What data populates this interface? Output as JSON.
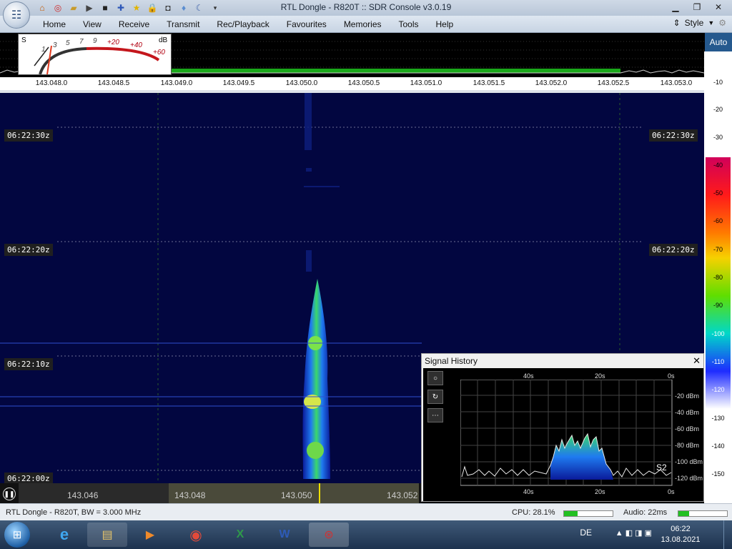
{
  "window": {
    "title": "RTL Dongle - R820T :: SDR Console v3.0.19",
    "controls": [
      "minimize-icon",
      "restore-icon",
      "close-icon"
    ]
  },
  "quick_access": [
    "home-icon",
    "lifebuoy-icon",
    "folder-icon",
    "play-icon",
    "stop-icon",
    "plus-icon",
    "star-icon",
    "lock-icon",
    "camera-icon",
    "drop-icon",
    "moon-icon",
    "dropdown-icon"
  ],
  "ribbon": {
    "tabs": [
      "Home",
      "View",
      "Receive",
      "Transmit",
      "Rec/Playback",
      "Favourites",
      "Memories",
      "Tools",
      "Help"
    ],
    "style_label": "Style"
  },
  "smeter": {
    "s_label": "S",
    "db_label": "dB",
    "ticks": [
      "1",
      "3",
      "5",
      "7",
      "9",
      "+20",
      "+40",
      "+60"
    ]
  },
  "spectrum": {
    "auto_label": "Auto",
    "freq_ticks": [
      "143.048.0",
      "143.048.5",
      "143.049.0",
      "143.049.5",
      "143.050.0",
      "143.050.5",
      "143.051.0",
      "143.051.5",
      "143.052.0",
      "143.052.5",
      "143.053.0"
    ]
  },
  "db_scale": {
    "ticks": [
      "-10",
      "-20",
      "-30",
      "-40",
      "-50",
      "-60",
      "-70",
      "-80",
      "-90",
      "-100",
      "-110",
      "-120",
      "-130",
      "-140",
      "-150"
    ],
    "colors": [
      "#e0005a",
      "#ff1a1a",
      "#ff3300",
      "#ffa500",
      "#d4e800",
      "#40d000",
      "#00c0a0",
      "#1040ff",
      "#1010a0",
      "#0a0a50",
      "#ffffff",
      "#ffffff"
    ]
  },
  "waterfall": {
    "timestamps": [
      "06:22:30z",
      "06:22:20z",
      "06:22:10z",
      "06:22:00z"
    ],
    "background": "#020640"
  },
  "bottom_freq": {
    "labels": [
      "143.046",
      "143.048",
      "143.050",
      "143.052"
    ]
  },
  "signal_history": {
    "title": "Signal History",
    "top_ticks": [
      "40s",
      "20s",
      "0s"
    ],
    "bottom_ticks": [
      "40s",
      "20s",
      "0s"
    ],
    "y_ticks": [
      "-20 dBm",
      "-40 dBm",
      "-60 dBm",
      "-80 dBm",
      "-100 dBm",
      "-120 dBm"
    ],
    "s_reading": "S2",
    "buttons": [
      "circle-icon",
      "refresh-icon",
      "more-icon"
    ]
  },
  "status": {
    "device": "RTL Dongle - R820T, BW = 3.000 MHz",
    "cpu": "CPU: 28.1%",
    "cpu_fraction": 0.28,
    "audio": "Audio: 22ms",
    "audio_fraction": 0.22
  },
  "taskbar": {
    "apps": [
      "ie-icon",
      "explorer-icon",
      "media-player-icon",
      "chrome-icon",
      "excel-icon",
      "word-icon",
      "sdr-console-icon"
    ],
    "language": "DE",
    "time": "06:22",
    "date": "13.08.2021"
  }
}
